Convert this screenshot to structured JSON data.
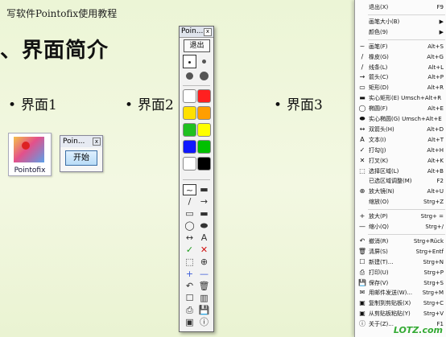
{
  "slide": {
    "header": "写软件Pointofix使用教程",
    "title": "、界面简介",
    "bullets": [
      "界面1",
      "界面2",
      "界面3"
    ]
  },
  "desktop_icon": {
    "label": "Pointofix"
  },
  "mini_window": {
    "title": "Poin...",
    "close": "x",
    "button": "开始"
  },
  "toolbar": {
    "title": "Poin...",
    "close": "x",
    "exit": "退出",
    "colors": [
      "#ffffff",
      "#ff2020",
      "#ffe000",
      "#ff9e00",
      "#20c020",
      "#ffff00",
      "#1018ff",
      "#00c000",
      "#ffffff",
      "#000000"
    ],
    "tool_glyphs": [
      "~",
      "▬",
      "/",
      "→",
      "▭",
      "▬",
      "◯",
      "⬬",
      "↔",
      "A",
      "✓",
      "✕",
      "⬚",
      "⊕",
      "+",
      "—",
      "↶",
      "🗑",
      "☐",
      "▥",
      "⎙",
      "💾",
      "▣",
      "ⓘ"
    ]
  },
  "menu": {
    "items": [
      {
        "icon": "",
        "text": "退出(X)",
        "shortcut": "F9"
      },
      {
        "sep": true
      },
      {
        "icon": "",
        "text": "画笔大小(B)",
        "shortcut": "▶"
      },
      {
        "icon": "",
        "text": "颜色(9)",
        "shortcut": "▶"
      },
      {
        "sep": true
      },
      {
        "icon": "~",
        "text": "画笔(F)",
        "shortcut": "Alt+S"
      },
      {
        "icon": "/",
        "text": "橡皮(G)",
        "shortcut": "Alt+G"
      },
      {
        "icon": "/",
        "text": "线条(L)",
        "shortcut": "Alt+L"
      },
      {
        "icon": "→",
        "text": "箭头(C)",
        "shortcut": "Alt+P"
      },
      {
        "icon": "▭",
        "text": "矩形(D)",
        "shortcut": "Alt+R"
      },
      {
        "icon": "▬",
        "text": "实心矩形(E) Umsch+Alt+R",
        "shortcut": ""
      },
      {
        "icon": "◯",
        "text": "椭圆(F)",
        "shortcut": "Alt+E"
      },
      {
        "icon": "⬬",
        "text": "实心椭圆(G) Umsch+Alt+E",
        "shortcut": ""
      },
      {
        "icon": "↔",
        "text": "双箭头(H)",
        "shortcut": "Alt+D"
      },
      {
        "icon": "A",
        "text": "文本(I)",
        "shortcut": "Alt+T"
      },
      {
        "icon": "✓",
        "text": "打勾(J)",
        "shortcut": "Alt+H"
      },
      {
        "icon": "✕",
        "text": "打叉(K)",
        "shortcut": "Alt+K"
      },
      {
        "icon": "⬚",
        "text": "选择区域(L)",
        "shortcut": "Alt+B"
      },
      {
        "icon": "",
        "text": "已选区域调整(M)",
        "shortcut": "F2"
      },
      {
        "icon": "⊕",
        "text": "放大镜(N)",
        "shortcut": "Alt+U"
      },
      {
        "icon": "",
        "text": "缩放(O)",
        "shortcut": "Strg+Z"
      },
      {
        "sep": true
      },
      {
        "icon": "+",
        "text": "放大(P)",
        "shortcut": "Strg+ ="
      },
      {
        "icon": "—",
        "text": "缩小(Q)",
        "shortcut": "Strg+/"
      },
      {
        "sep": true
      },
      {
        "icon": "↶",
        "text": "撤消(R)",
        "shortcut": "Strg+Rück"
      },
      {
        "icon": "🗑",
        "text": "清屏(S)",
        "shortcut": "Strg+Entf"
      },
      {
        "icon": "☐",
        "text": "新建(T)...",
        "shortcut": "Strg+N"
      },
      {
        "icon": "⎙",
        "text": "打印(U)",
        "shortcut": "Strg+P"
      },
      {
        "icon": "💾",
        "text": "保存(V)",
        "shortcut": "Strg+S"
      },
      {
        "icon": "✉",
        "text": "用邮件发送(W)...",
        "shortcut": "Strg+M"
      },
      {
        "icon": "▣",
        "text": "复制到剪贴板(X)",
        "shortcut": "Strg+C"
      },
      {
        "icon": "▣",
        "text": "从剪贴板粘贴(Y)",
        "shortcut": "Strg+V"
      },
      {
        "icon": "ⓘ",
        "text": "关于(Z)...",
        "shortcut": "F1"
      }
    ]
  },
  "watermark": "LOTZ.com"
}
